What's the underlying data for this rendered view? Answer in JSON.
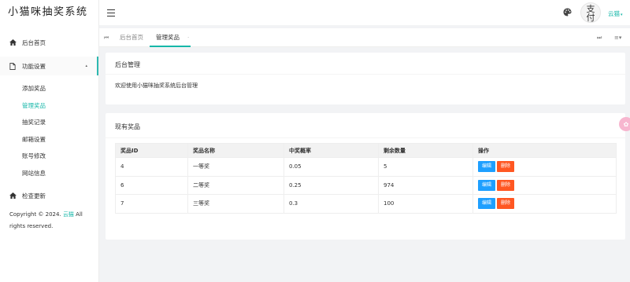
{
  "app": {
    "title": "小猫咪抽奖系统"
  },
  "sidebar": {
    "items": [
      {
        "label": "后台首页",
        "icon": "home-icon"
      },
      {
        "label": "功能设置",
        "icon": "file-icon",
        "open": true
      }
    ],
    "subitems": [
      {
        "label": "添加奖品"
      },
      {
        "label": "管理奖品",
        "active": true
      },
      {
        "label": "抽奖记录"
      },
      {
        "label": "邮箱设置"
      },
      {
        "label": "账号修改"
      },
      {
        "label": "网站信息"
      }
    ],
    "check_update": {
      "label": "检查更新",
      "icon": "home-icon"
    },
    "copyright": {
      "prefix": "Copyright © 2024.",
      "brand": "云猫",
      "suffix": "All rights reserved."
    }
  },
  "header": {
    "avatar_text": "支 付",
    "user_label": "云猫",
    "icons": [
      "menu-icon",
      "palette-icon",
      "chevron-down-icon"
    ]
  },
  "tabs": {
    "items": [
      {
        "label": "后台首页",
        "active": false
      },
      {
        "label": "管理奖品",
        "active": true
      }
    ],
    "icons": [
      "prev-tabs-icon",
      "close-icon",
      "next-tabs-icon",
      "tabs-menu-icon"
    ]
  },
  "card_admin": {
    "title": "后台管理",
    "text": "欢迎使用小猫咪抽奖系统后台管理"
  },
  "card_prizes": {
    "title": "现有奖品",
    "columns": [
      "奖品ID",
      "奖品名称",
      "中奖概率",
      "剩余数量",
      "操作"
    ],
    "rows": [
      {
        "id": "4",
        "name": "一等奖",
        "probability": "0.05",
        "remaining": "5"
      },
      {
        "id": "6",
        "name": "二等奖",
        "probability": "0.25",
        "remaining": "974"
      },
      {
        "id": "7",
        "name": "三等奖",
        "probability": "0.3",
        "remaining": "100"
      }
    ],
    "edit_label": "编辑",
    "delete_label": "删除"
  },
  "colors": {
    "accent": "#16b7a9",
    "edit": "#1e9fff",
    "delete": "#ff5722",
    "float": "#f7b6cf"
  }
}
